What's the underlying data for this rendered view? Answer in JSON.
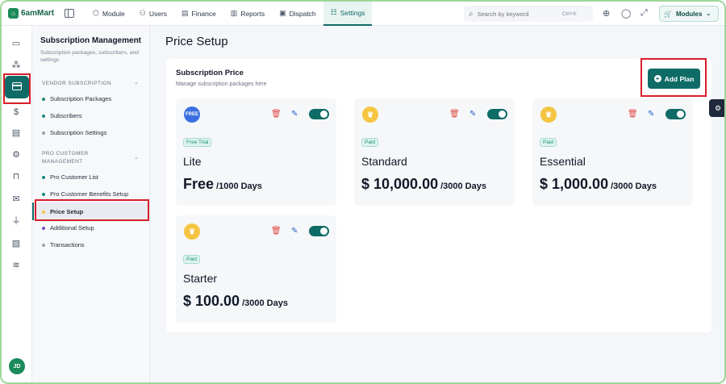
{
  "app": {
    "logo_text": "6amMart"
  },
  "nav": {
    "items": [
      {
        "label": "Module",
        "icon": "module-icon"
      },
      {
        "label": "Users",
        "icon": "users-icon"
      },
      {
        "label": "Finance",
        "icon": "finance-icon"
      },
      {
        "label": "Reports",
        "icon": "reports-icon"
      },
      {
        "label": "Dispatch",
        "icon": "dispatch-icon"
      },
      {
        "label": "Settings",
        "icon": "settings-icon",
        "active": true
      }
    ],
    "search_placeholder": "Search by keyword",
    "search_shortcut": "Ctrl+K",
    "modules_label": "Modules"
  },
  "rail": {
    "avatar_initials": "JD"
  },
  "submenu": {
    "title": "Subscription Management",
    "description": "Subscription packages, subscribers, and settings",
    "sections": [
      {
        "title": "VENDOR SUBSCRIPTION",
        "items": [
          {
            "label": "Subscription Packages",
            "dot_color": "#1b8a7a"
          },
          {
            "label": "Subscribers",
            "dot_color": "#1b8a7a"
          },
          {
            "label": "Subscription Settings",
            "dot_color": "#9aa3ae"
          }
        ]
      },
      {
        "title": "PRO CUSTOMER MANAGEMENT",
        "items": [
          {
            "label": "Pro Customer List",
            "dot_color": "#1b8a7a"
          },
          {
            "label": "Pro Customer Benefits Setup",
            "dot_color": "#1b8a7a"
          },
          {
            "label": "Price Setup",
            "dot_color": "#f5c542",
            "active": true
          },
          {
            "label": "Additional Setup",
            "dot_color": "#7c4dcc"
          },
          {
            "label": "Transactions",
            "dot_color": "#9aa3ae"
          }
        ]
      }
    ]
  },
  "main": {
    "page_title": "Price Setup",
    "panel_title": "Subscription Price",
    "panel_subtitle": "Manage subscription packages here",
    "add_button": "Add Plan",
    "plans": [
      {
        "badge": "FREE",
        "tag": "Free Trial",
        "name": "Lite",
        "price": "Free",
        "duration": "/1000 Days",
        "enabled": true
      },
      {
        "badge": "crown",
        "tag": "Paid",
        "name": "Standard",
        "price": "$ 10,000.00",
        "duration": "/3000 Days",
        "enabled": true
      },
      {
        "badge": "crown",
        "tag": "Paid",
        "name": "Essential",
        "price": "$ 1,000.00",
        "duration": "/3000 Days",
        "enabled": true
      },
      {
        "badge": "crown",
        "tag": "Paid",
        "name": "Starter",
        "price": "$ 100.00",
        "duration": "/3000 Days",
        "enabled": true
      }
    ]
  },
  "colors": {
    "accent": "#0f6b66",
    "highlight": "#d81e2c",
    "brand_green": "#1b8a5a"
  }
}
